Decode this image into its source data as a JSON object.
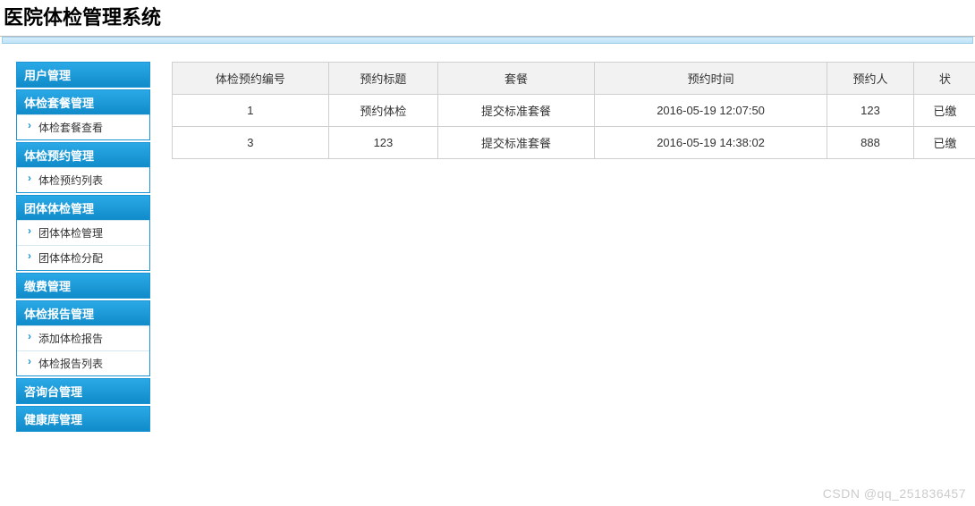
{
  "header": {
    "title": "医院体检管理系统"
  },
  "sidebar": [
    {
      "title": "用户管理",
      "items": []
    },
    {
      "title": "体检套餐管理",
      "items": [
        "体检套餐查看"
      ]
    },
    {
      "title": "体检预约管理",
      "items": [
        "体检预约列表"
      ]
    },
    {
      "title": "团体体检管理",
      "items": [
        "团体体检管理",
        "团体体检分配"
      ]
    },
    {
      "title": "缴费管理",
      "items": []
    },
    {
      "title": "体检报告管理",
      "items": [
        "添加体检报告",
        "体检报告列表"
      ]
    },
    {
      "title": "咨询台管理",
      "items": []
    },
    {
      "title": "健康库管理",
      "items": []
    }
  ],
  "table": {
    "headers": [
      "体检预约编号",
      "预约标题",
      "套餐",
      "预约时间",
      "预约人",
      "状"
    ],
    "rows": [
      [
        "1",
        "预约体检",
        "提交标准套餐",
        "2016-05-19 12:07:50",
        "123",
        "已缴"
      ],
      [
        "3",
        "123",
        "提交标准套餐",
        "2016-05-19 14:38:02",
        "888",
        "已缴"
      ]
    ]
  },
  "watermark": "CSDN @qq_251836457"
}
